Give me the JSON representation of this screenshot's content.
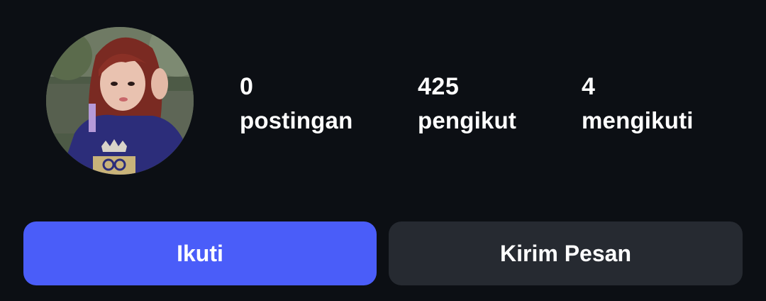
{
  "profile": {
    "avatar_icon": "profile-photo"
  },
  "stats": {
    "posts": {
      "value": "0",
      "label": "postingan"
    },
    "followers": {
      "value": "425",
      "label": "pengikut"
    },
    "following": {
      "value": "4",
      "label": "mengikuti"
    }
  },
  "actions": {
    "follow_label": "Ikuti",
    "message_label": "Kirim Pesan"
  },
  "colors": {
    "background": "#0c0f14",
    "follow_button": "#4a5df9",
    "message_button": "#262a31",
    "text": "#ffffff"
  }
}
